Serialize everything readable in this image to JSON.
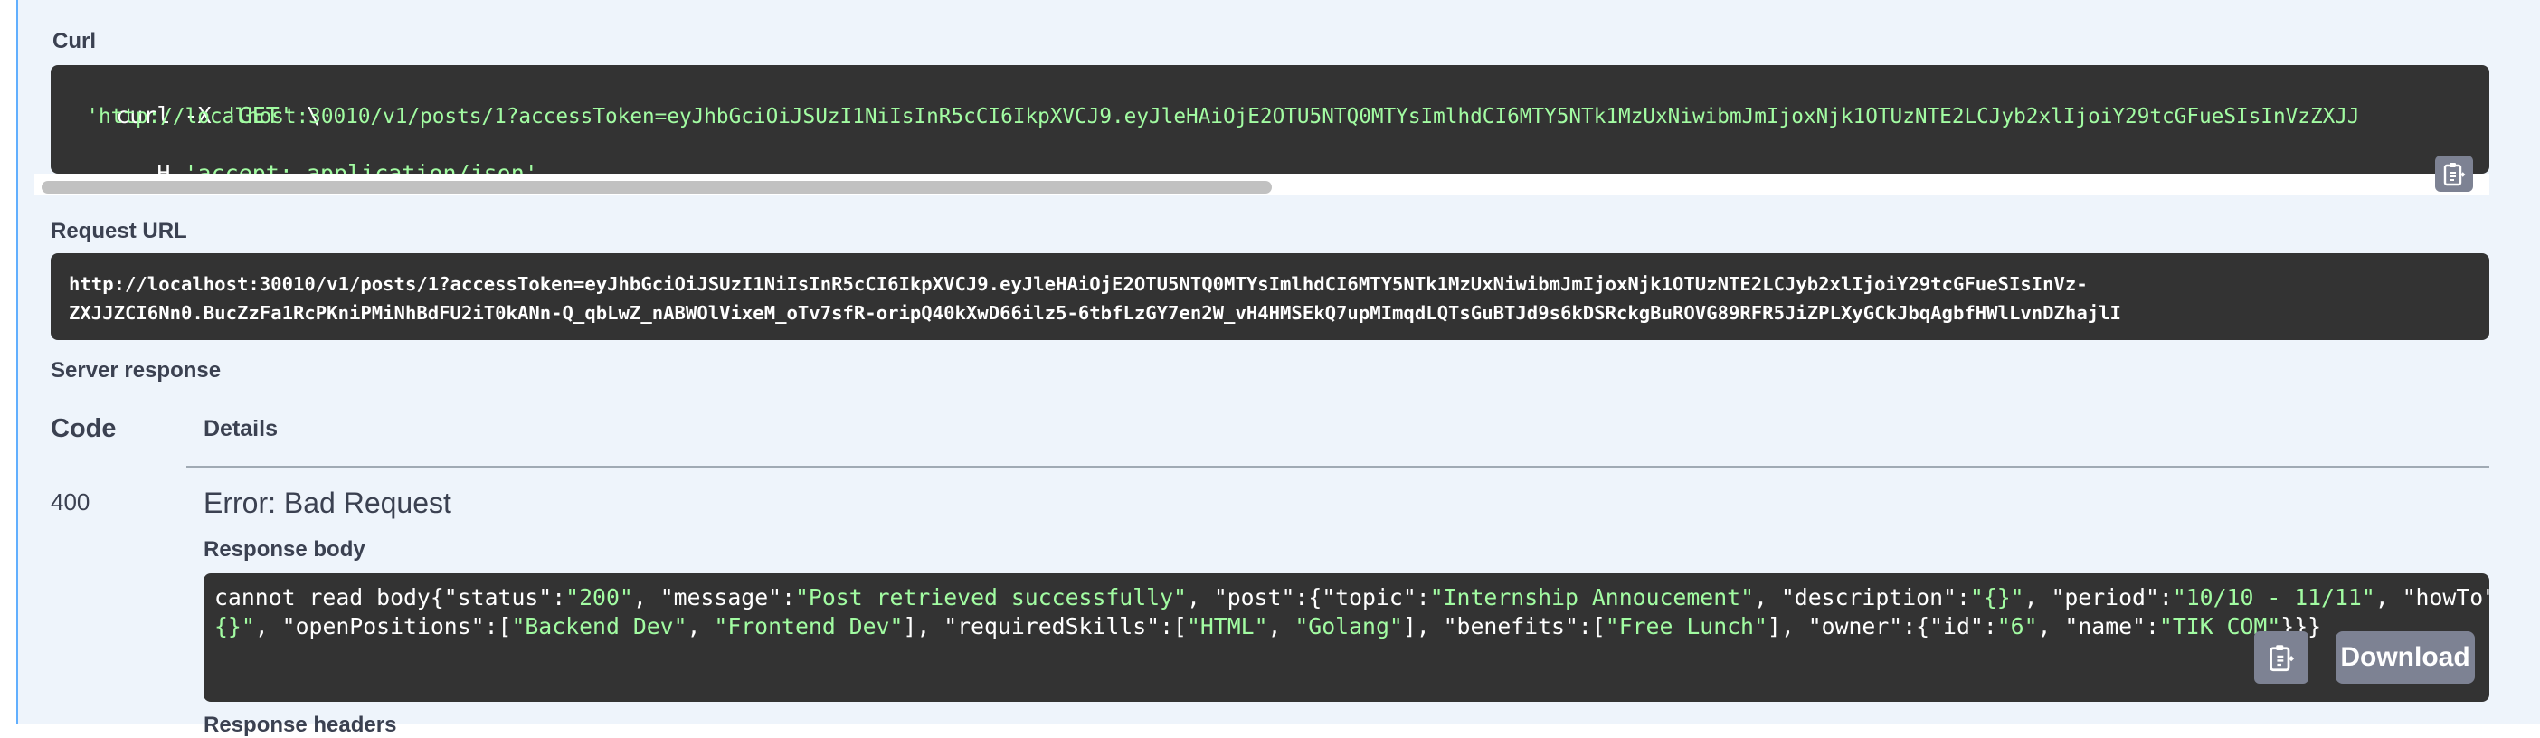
{
  "curl": {
    "label": "Curl",
    "line1_cmd": "curl -X ",
    "line1_method": "'GET'",
    "line1_tail": " \\",
    "line2_url": "  'http://localhost:30010/v1/posts/1?accessToken=eyJhbGciOiJSUzI1NiIsInR5cCI6IkpXVCJ9.eyJleHAiOjE2OTU5NTQ0MTYsImlhdCI6MTY5NTk1MzUxNiwibmJmIjoxNjk1OTUzNTE2LCJyb2xlIjoiY29tcGFueSIsInVzZXJJ",
    "line3_flag": "  -H ",
    "line3_header": "'accept: application/json'"
  },
  "request_url": {
    "label": "Request URL",
    "line1": "http://localhost:30010/v1/posts/1?accessToken=eyJhbGciOiJSUzI1NiIsInR5cCI6IkpXVCJ9.eyJleHAiOjE2OTU5NTQ0MTYsImlhdCI6MTY5NTk1MzUxNiwibmJmIjoxNjk1OTUzNTE2LCJyb2xlIjoiY29tcGFueSIsInVz-",
    "line2": "ZXJJZCI6Nn0.BucZzFa1RcPKniPMiNhBdFU2iT0kANn-Q_qbLwZ_nABWOlVixeM_oTv7sfR-oripQ40kXwD66ilz5-6tbfLzGY7en2W_vH4HMSEkQ7upMImqdLQTsGuBTJd9s6kDSRckgBuROVG89RFR5JiZPLXyGCkJbqAgbfHWlLvnDZhajlI"
  },
  "server_response": {
    "label": "Server response",
    "code_header": "Code",
    "details_header": "Details",
    "code": "400",
    "error_title": "Error: Bad Request",
    "body_label": "Response body",
    "next_label": "Response headers",
    "download_label": "Download"
  },
  "response_body": {
    "line1": [
      {
        "t": "cannot read body{",
        "c": "w"
      },
      {
        "t": "\"status\"",
        "c": "w"
      },
      {
        "t": ":",
        "c": "w"
      },
      {
        "t": "\"200\"",
        "c": "s"
      },
      {
        "t": ", ",
        "c": "w"
      },
      {
        "t": "\"message\"",
        "c": "w"
      },
      {
        "t": ":",
        "c": "w"
      },
      {
        "t": "\"Post retrieved successfully\"",
        "c": "s"
      },
      {
        "t": ", ",
        "c": "w"
      },
      {
        "t": "\"post\"",
        "c": "w"
      },
      {
        "t": ":{",
        "c": "w"
      },
      {
        "t": "\"topic\"",
        "c": "w"
      },
      {
        "t": ":",
        "c": "w"
      },
      {
        "t": "\"Internship Annoucement\"",
        "c": "s"
      },
      {
        "t": ", ",
        "c": "w"
      },
      {
        "t": "\"description\"",
        "c": "w"
      },
      {
        "t": ":",
        "c": "w"
      },
      {
        "t": "\"{}\"",
        "c": "s"
      },
      {
        "t": ", ",
        "c": "w"
      },
      {
        "t": "\"period\"",
        "c": "w"
      },
      {
        "t": ":",
        "c": "w"
      },
      {
        "t": "\"10/10 - 11/11\"",
        "c": "s"
      },
      {
        "t": ", ",
        "c": "w"
      },
      {
        "t": "\"howTo\"",
        "c": "w"
      },
      {
        "t": ":",
        "c": "w"
      },
      {
        "t": "\"",
        "c": "s"
      }
    ],
    "line2": [
      {
        "t": "{}\"",
        "c": "s"
      },
      {
        "t": ", ",
        "c": "w"
      },
      {
        "t": "\"openPositions\"",
        "c": "w"
      },
      {
        "t": ":[",
        "c": "w"
      },
      {
        "t": "\"Backend Dev\"",
        "c": "s"
      },
      {
        "t": ", ",
        "c": "w"
      },
      {
        "t": "\"Frontend Dev\"",
        "c": "s"
      },
      {
        "t": "], ",
        "c": "w"
      },
      {
        "t": "\"requiredSkills\"",
        "c": "w"
      },
      {
        "t": ":[",
        "c": "w"
      },
      {
        "t": "\"HTML\"",
        "c": "s"
      },
      {
        "t": ", ",
        "c": "w"
      },
      {
        "t": "\"Golang\"",
        "c": "s"
      },
      {
        "t": "], ",
        "c": "w"
      },
      {
        "t": "\"benefits\"",
        "c": "w"
      },
      {
        "t": ":[",
        "c": "w"
      },
      {
        "t": "\"Free Lunch\"",
        "c": "s"
      },
      {
        "t": "], ",
        "c": "w"
      },
      {
        "t": "\"owner\"",
        "c": "w"
      },
      {
        "t": ":{",
        "c": "w"
      },
      {
        "t": "\"id\"",
        "c": "w"
      },
      {
        "t": ":",
        "c": "w"
      },
      {
        "t": "\"6\"",
        "c": "s"
      },
      {
        "t": ", ",
        "c": "w"
      },
      {
        "t": "\"name\"",
        "c": "w"
      },
      {
        "t": ":",
        "c": "w"
      },
      {
        "t": "\"TIK COM\"",
        "c": "s"
      },
      {
        "t": "}}}",
        "c": "w"
      }
    ]
  },
  "colors": {
    "code_bg": "#333333",
    "string": "#a2fca2",
    "panel_bg": "#eef4fb",
    "accent_border": "#61affe",
    "button_bg": "#7d8293"
  },
  "icons": {
    "copy": "copy-to-clipboard-icon"
  }
}
